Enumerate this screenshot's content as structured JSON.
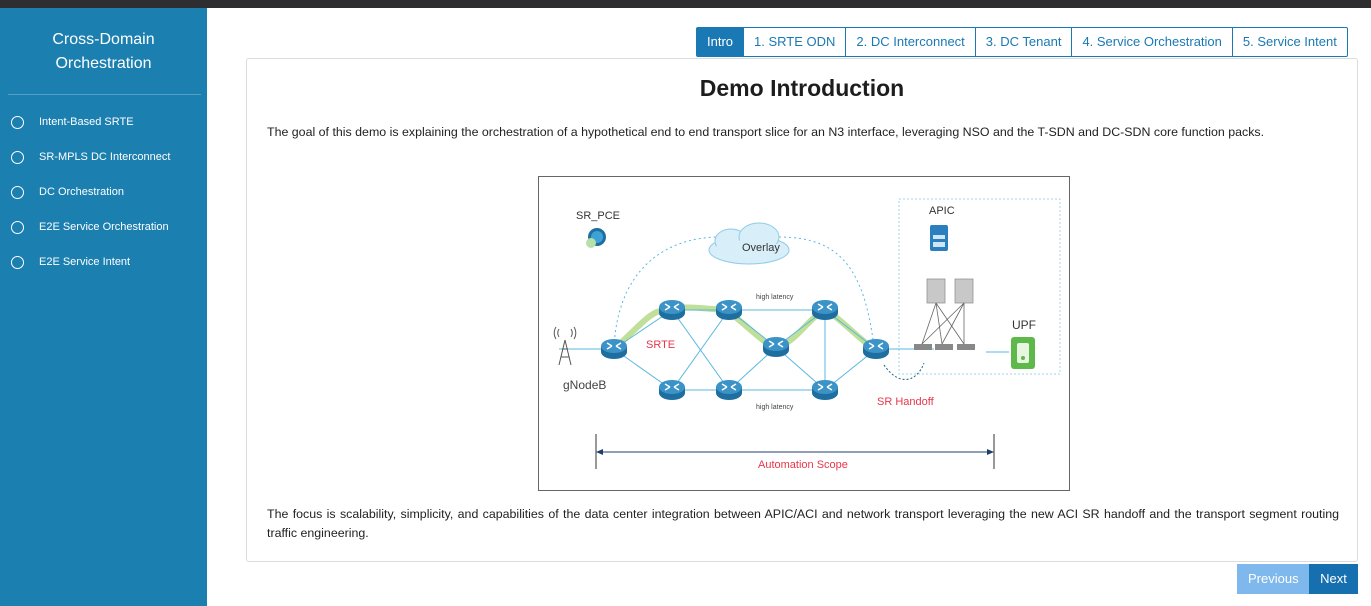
{
  "sidebar": {
    "title_line1": "Cross-Domain",
    "title_line2": "Orchestration",
    "items": [
      {
        "label": "Intent-Based SRTE"
      },
      {
        "label": "SR-MPLS DC Interconnect"
      },
      {
        "label": "DC Orchestration"
      },
      {
        "label": "E2E Service Orchestration"
      },
      {
        "label": "E2E Service Intent"
      }
    ]
  },
  "tabs": [
    {
      "label": "Intro",
      "active": true
    },
    {
      "label": "1. SRTE ODN"
    },
    {
      "label": "2. DC Interconnect"
    },
    {
      "label": "3. DC Tenant"
    },
    {
      "label": "4. Service Orchestration"
    },
    {
      "label": "5. Service Intent"
    }
  ],
  "main": {
    "title": "Demo Introduction",
    "paragraph1": "The goal of this demo is explaining the orchestration of a hypothetical end to end transport slice for an N3 interface, leveraging NSO and the T-SDN and DC-SDN core function packs.",
    "paragraph2": "The focus is scalability, simplicity, and capabilities of the data center integration between APIC/ACI and network transport leveraging the new ACI SR handoff and the transport segment routing traffic engineering."
  },
  "diagram": {
    "sr_pce": "SR_PCE",
    "overlay": "Overlay",
    "apic": "APIC",
    "upf": "UPF",
    "srte": "SRTE",
    "gnodeb": "gNodeB",
    "high_latency_top": "high latency",
    "high_latency_bottom": "high latency",
    "sr_handoff": "SR Handoff",
    "automation_scope": "Automation Scope"
  },
  "nav": {
    "previous": "Previous",
    "next": "Next"
  },
  "colors": {
    "sidebar": "#1b7fb0",
    "accent": "#1a79b5",
    "previous_button": "#7fb8ec",
    "next_button": "#1670b0",
    "diagram_red": "#e8364a"
  }
}
